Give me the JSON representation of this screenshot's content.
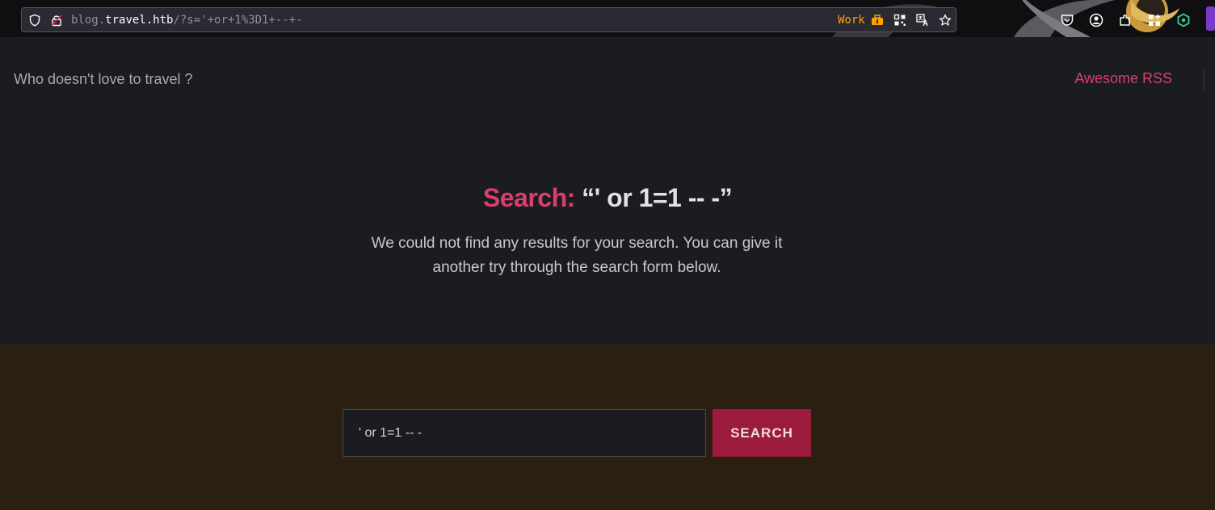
{
  "browser": {
    "url_prefix": "blog.",
    "url_host": "travel.htb",
    "url_path": "/?s='+or+1%3D1+--+-",
    "container_label": "Work",
    "colors": {
      "container": "#ff9f00",
      "urlbar_bg": "#2b2a33"
    },
    "icons": {
      "shield": "shield-icon",
      "lock": "lock-icon",
      "container": "briefcase-icon",
      "qr": "qr-code-icon",
      "translate": "translate-icon",
      "bookmark": "bookmark-star-icon",
      "pocket": "pocket-icon",
      "account": "account-icon",
      "extensions": "extensions-icon",
      "apps": "apps-icon",
      "hexagon": "hexagon-extension-icon"
    }
  },
  "site": {
    "description": "Who doesn't love to travel ?",
    "menu": [
      {
        "label": "Awesome RSS"
      }
    ],
    "accent_color": "#d6406a"
  },
  "archive": {
    "title_label": "Search:",
    "title_query": "“' or 1=1 -- -”",
    "subtitle": "We could not find any results for your search. You can give it another try through the search form below."
  },
  "search_form": {
    "value": "' or 1=1 -- -",
    "button_label": "Search",
    "background_color": "#2a1f10",
    "button_color": "#9c1a3c"
  }
}
